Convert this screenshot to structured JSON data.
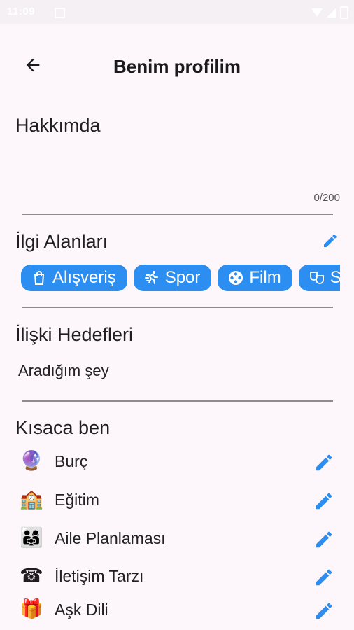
{
  "status_bar": {
    "time": "11:09"
  },
  "header": {
    "title": "Benim profilim"
  },
  "about": {
    "heading": "Hakkımda",
    "counter": "0/200"
  },
  "interests": {
    "heading": "İlgi Alanları",
    "chips": [
      {
        "label": "Alışveriş",
        "icon": "shopping-bag-icon"
      },
      {
        "label": "Spor",
        "icon": "running-icon"
      },
      {
        "label": "Film",
        "icon": "film-reel-icon"
      },
      {
        "label": "So",
        "icon": "theater-masks-icon"
      }
    ]
  },
  "relationship_goals": {
    "heading": "İlişki Hedefleri",
    "value": "Aradığım şey"
  },
  "about_me": {
    "heading": "Kısaca ben",
    "items": [
      {
        "label": "Burç",
        "emoji": "🔮"
      },
      {
        "label": "Eğitim",
        "emoji": "🏫"
      },
      {
        "label": "Aile Planlaması",
        "emoji": "👨‍👩‍👧"
      },
      {
        "label": "İletişim Tarzı",
        "emoji": "☎"
      },
      {
        "label": "Aşk Dili",
        "emoji": "🎁"
      }
    ]
  },
  "colors": {
    "accent": "#2b8ef0",
    "background": "#fdf6fb",
    "divider": "#8f8a8f"
  }
}
